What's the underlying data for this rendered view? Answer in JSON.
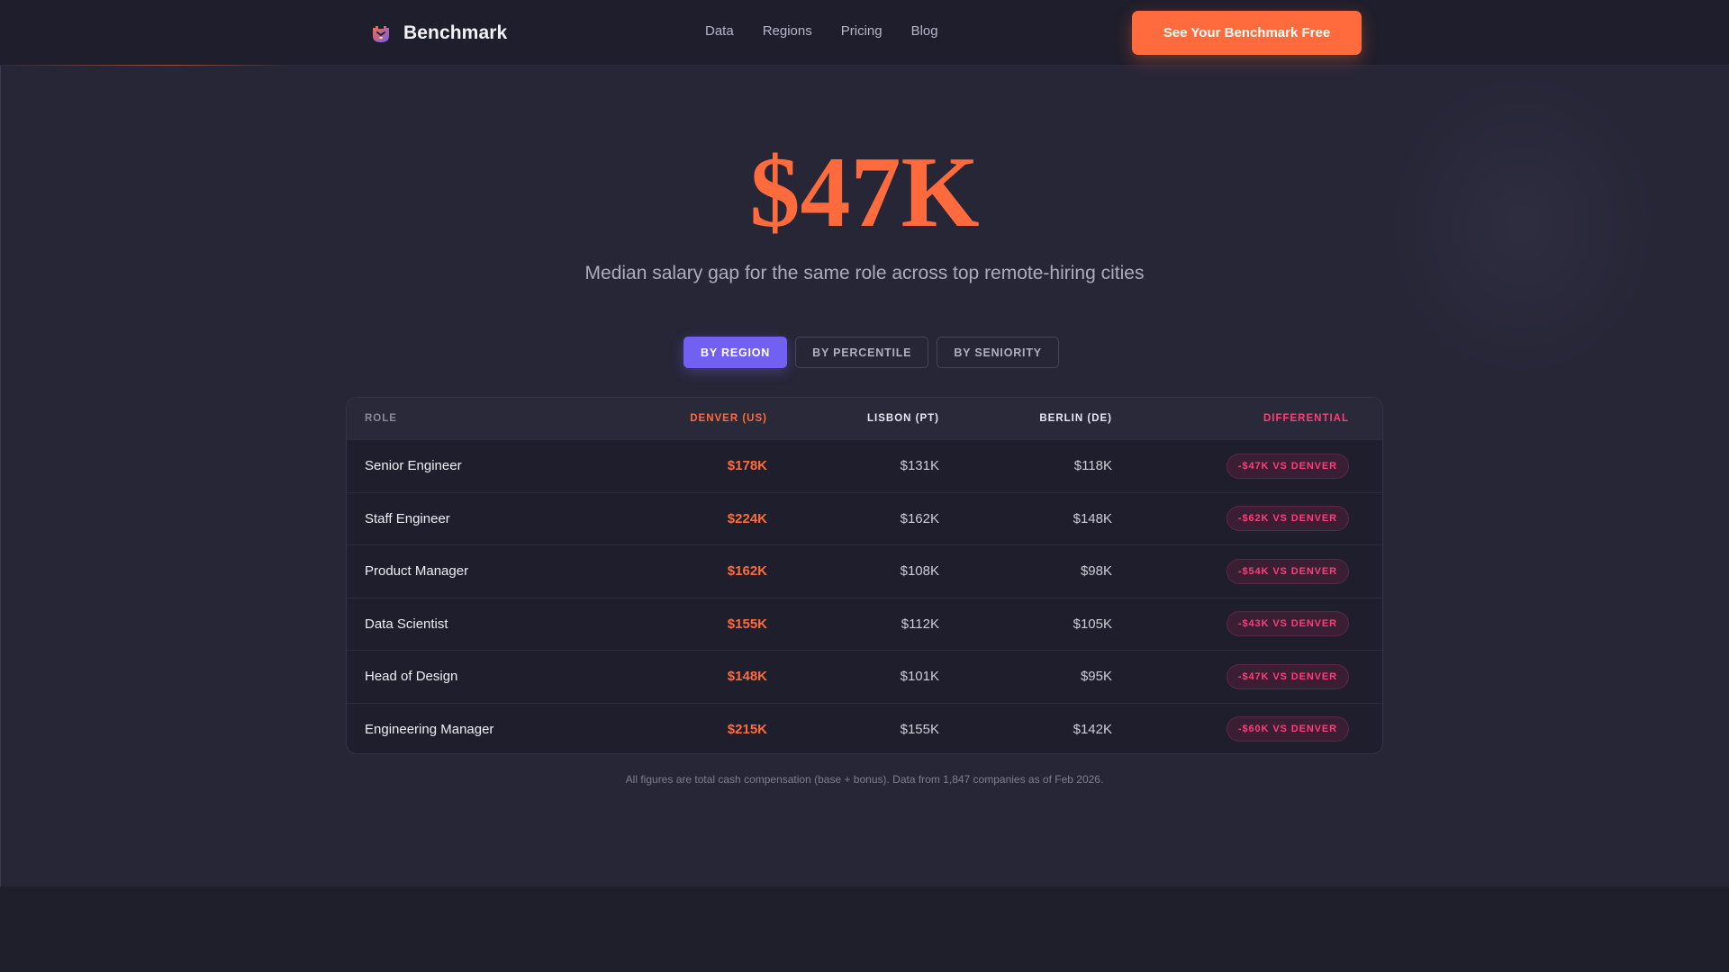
{
  "nav": {
    "brand": "Benchmark",
    "links": [
      "Data",
      "Regions",
      "Pricing",
      "Blog"
    ],
    "cta": "See Your Benchmark Free"
  },
  "hero": {
    "headline": "$47K",
    "subheadline": "Median salary gap for the same role across top remote-hiring cities"
  },
  "tabs": [
    {
      "label": "BY REGION",
      "active": true
    },
    {
      "label": "BY PERCENTILE",
      "active": false
    },
    {
      "label": "BY SENIORITY",
      "active": false
    }
  ],
  "table": {
    "headers": {
      "role": "ROLE",
      "denver": "DENVER (US)",
      "lisbon": "LISBON (PT)",
      "berlin": "BERLIN (DE)",
      "differential": "DIFFERENTIAL"
    },
    "rows": [
      {
        "role": "Senior Engineer",
        "denver": "$178K",
        "lisbon": "$131K",
        "berlin": "$118K",
        "differential": "-$47K VS DENVER"
      },
      {
        "role": "Staff Engineer",
        "denver": "$224K",
        "lisbon": "$162K",
        "berlin": "$148K",
        "differential": "-$62K VS DENVER"
      },
      {
        "role": "Product Manager",
        "denver": "$162K",
        "lisbon": "$108K",
        "berlin": "$98K",
        "differential": "-$54K VS DENVER"
      },
      {
        "role": "Data Scientist",
        "denver": "$155K",
        "lisbon": "$112K",
        "berlin": "$105K",
        "differential": "-$43K VS DENVER"
      },
      {
        "role": "Head of Design",
        "denver": "$148K",
        "lisbon": "$101K",
        "berlin": "$95K",
        "differential": "-$47K VS DENVER"
      },
      {
        "role": "Engineering Manager",
        "denver": "$215K",
        "lisbon": "$155K",
        "berlin": "$142K",
        "differential": "-$60K VS DENVER"
      }
    ]
  },
  "footnote": "All figures are total cash compensation (base + bonus). Data from 1,847 companies as of Feb 2026.",
  "colors": {
    "accent_orange": "#ff6b3d",
    "accent_purple": "#7260f2",
    "accent_pink": "#ff3d7a",
    "background": "#272637",
    "nav_background": "#1f1e2c"
  },
  "icons": {
    "logo": "benchmark-logo-icon"
  }
}
